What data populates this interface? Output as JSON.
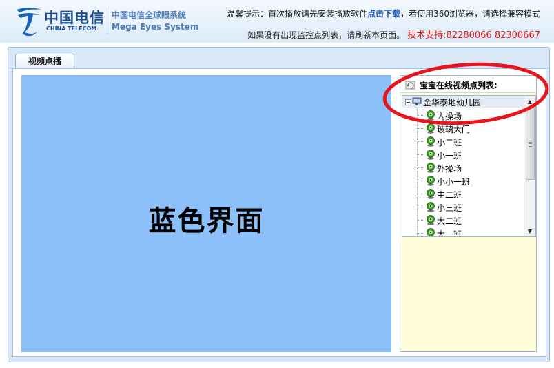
{
  "header": {
    "logo_cn": "中国电信",
    "logo_en": "CHINA TELECOM",
    "system_name_cn": "中国电信全球眼系统",
    "system_name_en": "Mega Eyes System",
    "notice_line1_prefix": "温馨提示：首次播放请先安装播放软件",
    "notice_line1_link": "点击下载",
    "notice_line1_suffix": "，若使用360浏览器，请选择兼容模式",
    "notice_line2": "如果没有出现监控点列表，请刷新本页面。",
    "support_text": "技术支持:82280066  82300667"
  },
  "tabs": [
    {
      "label": "视频点播"
    }
  ],
  "video": {
    "overlay_text": "蓝色界面"
  },
  "camera_list": {
    "title": "宝宝在线视频点列表:",
    "root": "金华泰地幼儿园",
    "cameras": [
      "内操场",
      "玻璃大门",
      "小二班",
      "小一班",
      "外操场",
      "小小一班",
      "中二班",
      "小三班",
      "大二班",
      "大一班"
    ]
  },
  "colors": {
    "video_bg": "#8cc0f8",
    "support_red": "#e8190f",
    "download_link": "#1c56b3",
    "annotation_red": "#e8131b"
  }
}
